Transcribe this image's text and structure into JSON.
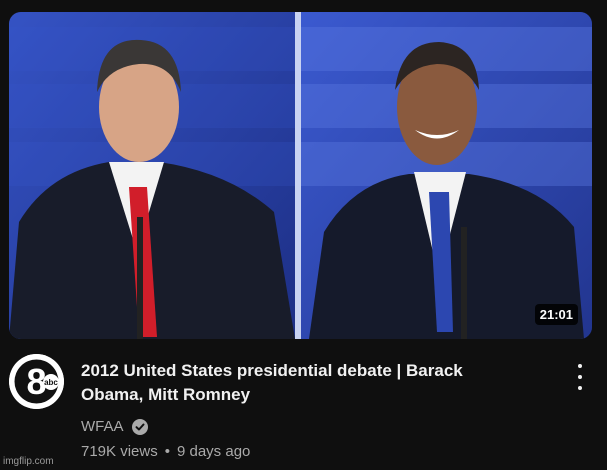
{
  "video": {
    "duration": "21:01",
    "title": "2012 United States presidential debate | Barack Obama, Mitt Romney",
    "channel": "WFAA",
    "views": "719K views",
    "age": "9 days ago",
    "separator": "•"
  },
  "channel_logo": {
    "number": "8",
    "network": "abc"
  },
  "watermark": "imgflip.com",
  "colors": {
    "background": "#0f0f0f",
    "backdrop": "#2a45b8",
    "secondary_text": "#aaaaaa"
  }
}
